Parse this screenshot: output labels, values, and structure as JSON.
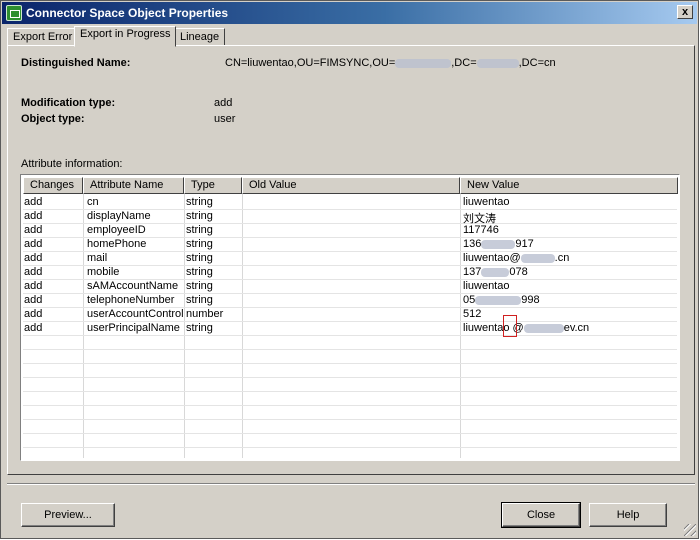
{
  "window": {
    "title": "Connector Space Object Properties",
    "close_glyph": "x"
  },
  "tabs": [
    {
      "label": "Export Error",
      "active": false
    },
    {
      "label": "Export in Progress",
      "active": true
    },
    {
      "label": "Lineage",
      "active": false
    }
  ],
  "details": {
    "dn_label": "Distinguished Name:",
    "dn_value_a": "CN=liuwentao,OU=FIMSYNC,OU=",
    "dn_value_b": ",DC=",
    "dn_value_c": ",DC=cn",
    "mod_type_label": "Modification type:",
    "mod_type_value": "add",
    "obj_type_label": "Object type:",
    "obj_type_value": "user"
  },
  "attributes": {
    "section_label": "Attribute information:",
    "columns": [
      "Changes",
      "Attribute Name",
      "Type",
      "Old Value",
      "New Value"
    ],
    "rows": [
      {
        "change": "add",
        "name": "cn",
        "type": "string",
        "old": "",
        "new_a": "liuwentao",
        "new_b": ""
      },
      {
        "change": "add",
        "name": "displayName",
        "type": "string",
        "old": "",
        "new_a": "刘文涛",
        "new_b": ""
      },
      {
        "change": "add",
        "name": "employeeID",
        "type": "string",
        "old": "",
        "new_a": "117746",
        "new_b": ""
      },
      {
        "change": "add",
        "name": "homePhone",
        "type": "string",
        "old": "",
        "new_a": "136",
        "new_b": "917"
      },
      {
        "change": "add",
        "name": "mail",
        "type": "string",
        "old": "",
        "new_a": "liuwentao@",
        "new_b": ".cn"
      },
      {
        "change": "add",
        "name": "mobile",
        "type": "string",
        "old": "",
        "new_a": "137",
        "new_b": "078"
      },
      {
        "change": "add",
        "name": "sAMAccountName",
        "type": "string",
        "old": "",
        "new_a": "liuwentao",
        "new_b": ""
      },
      {
        "change": "add",
        "name": "telephoneNumber",
        "type": "string",
        "old": "",
        "new_a": "05",
        "new_b": "998"
      },
      {
        "change": "add",
        "name": "userAccountControl",
        "type": "number",
        "old": "",
        "new_a": "512",
        "new_b": ""
      },
      {
        "change": "add",
        "name": "userPrincipalName",
        "type": "string",
        "old": "",
        "new_a": "liuwentao @",
        "new_b": "ev.cn"
      }
    ]
  },
  "buttons": {
    "preview": "Preview...",
    "close": "Close",
    "help": "Help"
  },
  "colors": {
    "title_start": "#0a246a",
    "title_end": "#a6caf0",
    "face": "#d4d0c8",
    "highlight_box": "#d02020"
  }
}
